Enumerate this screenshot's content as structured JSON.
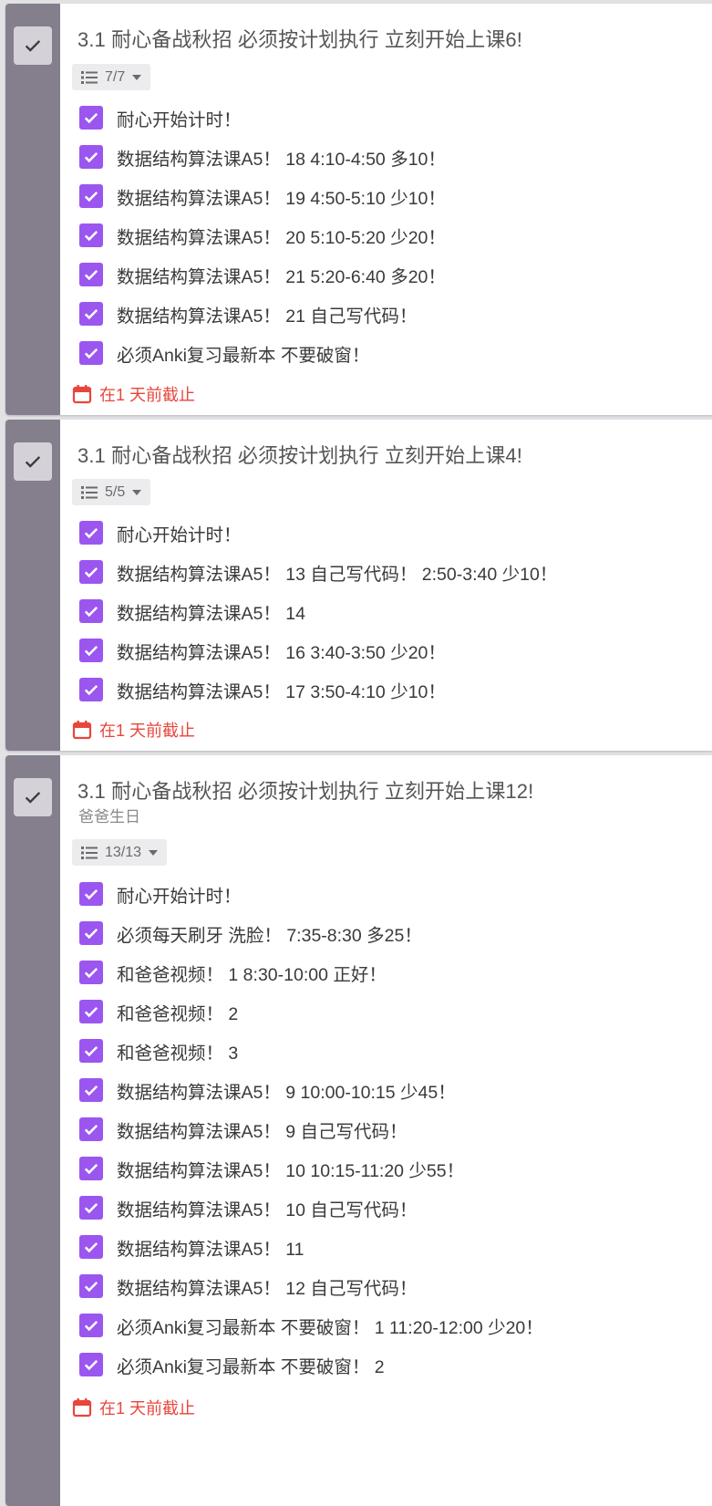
{
  "colors": {
    "sidebar": "#857f8d",
    "checkbox": "#9b56f0",
    "due": "#e8453c"
  },
  "tasks": [
    {
      "title": "3.1 耐心备战秋招 必须按计划执行 立刻开始上课6!",
      "notes": "",
      "checklist_count": "7/7",
      "items": [
        "耐心开始计时！",
        "数据结构算法课A5！ 18 4:10-4:50 多10！",
        "数据结构算法课A5！ 19 4:50-5:10 少10！",
        "数据结构算法课A5！ 20 5:10-5:20 少20！",
        "数据结构算法课A5！ 21 5:20-6:40 多20！",
        "数据结构算法课A5！ 21 自己写代码！",
        "必须Anki复习最新本 不要破窗！"
      ],
      "due": "在1 天前截止"
    },
    {
      "title": "3.1 耐心备战秋招 必须按计划执行 立刻开始上课4!",
      "notes": "",
      "checklist_count": "5/5",
      "items": [
        "耐心开始计时！",
        "数据结构算法课A5！ 13 自己写代码！ 2:50-3:40 少10！",
        "数据结构算法课A5！ 14",
        "数据结构算法课A5！ 16 3:40-3:50 少20！",
        "数据结构算法课A5！ 17 3:50-4:10 少10！"
      ],
      "due": "在1 天前截止"
    },
    {
      "title": "3.1 耐心备战秋招 必须按计划执行 立刻开始上课12!",
      "notes": "爸爸生日",
      "checklist_count": "13/13",
      "items": [
        "耐心开始计时！",
        "必须每天刷牙 洗脸！ 7:35-8:30 多25！",
        "和爸爸视频！ 1 8:30-10:00 正好！",
        "和爸爸视频！ 2",
        "和爸爸视频！ 3",
        "数据结构算法课A5！ 9 10:00-10:15 少45！",
        "数据结构算法课A5！ 9 自己写代码！",
        "数据结构算法课A5！ 10 10:15-11:20 少55！",
        "数据结构算法课A5！ 10 自己写代码！",
        "数据结构算法课A5！ 11",
        "数据结构算法课A5！ 12 自己写代码！",
        "必须Anki复习最新本 不要破窗！ 1 11:20-12:00 少20！",
        "必须Anki复习最新本 不要破窗！ 2"
      ],
      "due": "在1 天前截止"
    }
  ]
}
